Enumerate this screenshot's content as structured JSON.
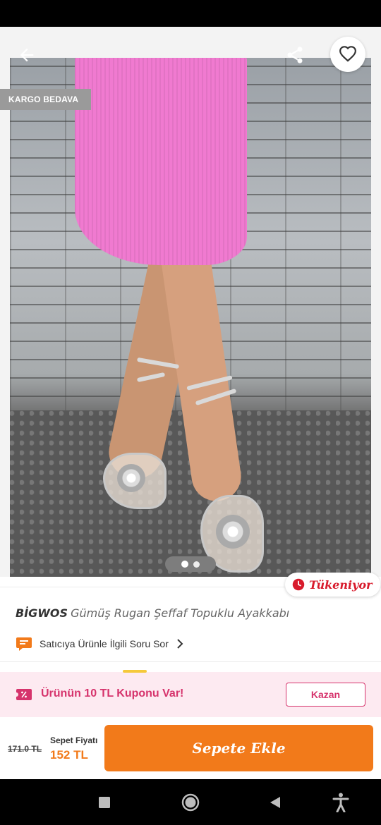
{
  "hero": {
    "free_shipping_badge": "KARGO BEDAVA",
    "pager": {
      "count": 2,
      "active": 0
    }
  },
  "stock_badge": {
    "label": "Tükeniyor",
    "color": "#d81b2c"
  },
  "product": {
    "brand": "BİGWOS",
    "name": "Gümüş Rugan Şeffaf Topuklu Ayakkabı"
  },
  "ask_seller": {
    "label": "Satıcıya Ürünle İlgili Soru Sor"
  },
  "coupon": {
    "text": "Ürünün 10 TL Kuponu Var!",
    "button_label": "Kazan",
    "accent": "#d6336c",
    "background": "#fdeaf1"
  },
  "cart": {
    "old_price": "171.0 TL",
    "basket_label": "Sepet Fiyatı",
    "basket_price": "152 TL",
    "add_button_label": "Sepete Ekle",
    "accent": "#f27a1a"
  },
  "icons": {
    "back": "arrow-back-icon",
    "share": "share-icon",
    "favorite": "heart-outline-icon",
    "stock": "clock-icon",
    "question": "chat-bubble-icon",
    "chevron": "chevron-right-icon",
    "coupon": "coupon-percent-icon",
    "nav_recent": "square-icon",
    "nav_home": "circle-icon",
    "nav_back": "triangle-back-icon",
    "nav_accessibility": "accessibility-icon"
  }
}
